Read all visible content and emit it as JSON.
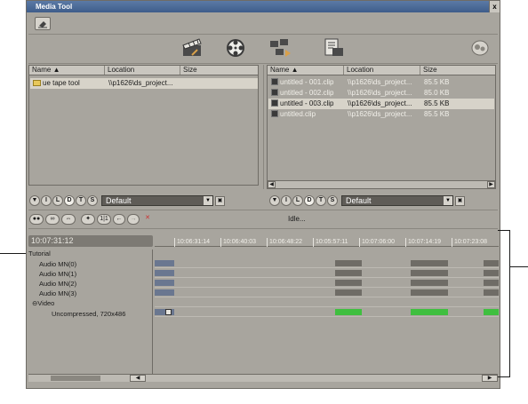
{
  "window": {
    "title": "Media Tool",
    "close_glyph": "x"
  },
  "toolbar": {
    "tool_icon": "eraser-icon"
  },
  "big_icons": [
    "import-clapper-icon",
    "film-reel-icon",
    "clip-capture-icon",
    "edl-icon",
    "settings-blob-icon"
  ],
  "left_pane": {
    "columns": [
      "Name",
      "Location",
      "Size"
    ],
    "rows": [
      {
        "name": "ue tape tool",
        "location": "\\\\p1626\\ds_project...",
        "size": ""
      }
    ]
  },
  "right_pane": {
    "columns": [
      "Name",
      "Location",
      "Size"
    ],
    "rows": [
      {
        "name": "untitled - 001.clip",
        "location": "\\\\p1626\\ds_project...",
        "size": "85.5 KB",
        "selected": false
      },
      {
        "name": "untitled - 002.clip",
        "location": "\\\\p1626\\ds_project...",
        "size": "85.0 KB",
        "selected": false
      },
      {
        "name": "untitled - 003.clip",
        "location": "\\\\p1626\\ds_project...",
        "size": "85.5 KB",
        "selected": true
      },
      {
        "name": "untitled.clip",
        "location": "\\\\p1626\\ds_project...",
        "size": "85.5 KB",
        "selected": false
      }
    ]
  },
  "filter_buttons": [
    "I",
    "L",
    "D",
    "T",
    "S"
  ],
  "filter_active": "D",
  "left_filter": {
    "preset": "Default"
  },
  "right_filter": {
    "preset": "Default"
  },
  "transport": {
    "status": "Idle...",
    "counter": "1|1"
  },
  "timeline": {
    "timecode": "10:07:31:12",
    "ruler_ticks": [
      "10:06:31:14",
      "10:06:40:03",
      "10:06:48:22",
      "10:05:57:11",
      "10:07:06:00",
      "10:07:14:19",
      "10:07:23:08"
    ],
    "tracks": {
      "root": "Tutorial",
      "audio": [
        "Audio MN(0)",
        "Audio MN(1)",
        "Audio MN(2)",
        "Audio MN(3)"
      ],
      "video_group": "Video",
      "video_format": "Uncompressed, 720x486"
    }
  },
  "colors": {
    "window_bg": "#a8a59e",
    "titlebar": "#4a6a96",
    "video_clip": "#3fbf3f"
  }
}
